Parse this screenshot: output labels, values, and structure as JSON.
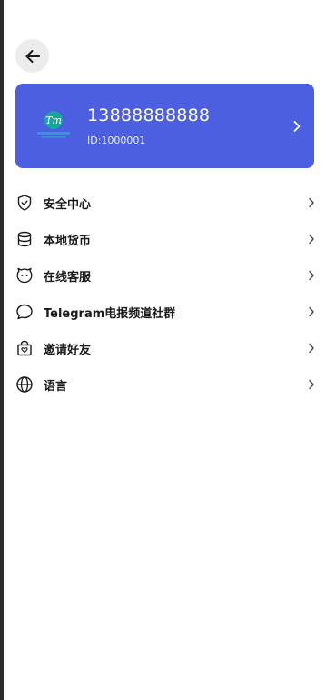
{
  "header": {
    "back_icon": "arrow-left-icon"
  },
  "profile": {
    "avatar_text": "Tm",
    "phone": "13888888888",
    "id_label": "ID:1000001",
    "card_color": "#4c5fe0"
  },
  "menu": {
    "items": [
      {
        "label": "安全中心",
        "icon": "shield-check-icon"
      },
      {
        "label": "本地货币",
        "icon": "database-icon"
      },
      {
        "label": "在线客服",
        "icon": "chat-face-icon"
      },
      {
        "label": "Telegram电报频道社群",
        "icon": "speech-bubble-icon"
      },
      {
        "label": "邀请好友",
        "icon": "gift-bag-icon"
      },
      {
        "label": "语言",
        "icon": "globe-icon"
      }
    ]
  }
}
